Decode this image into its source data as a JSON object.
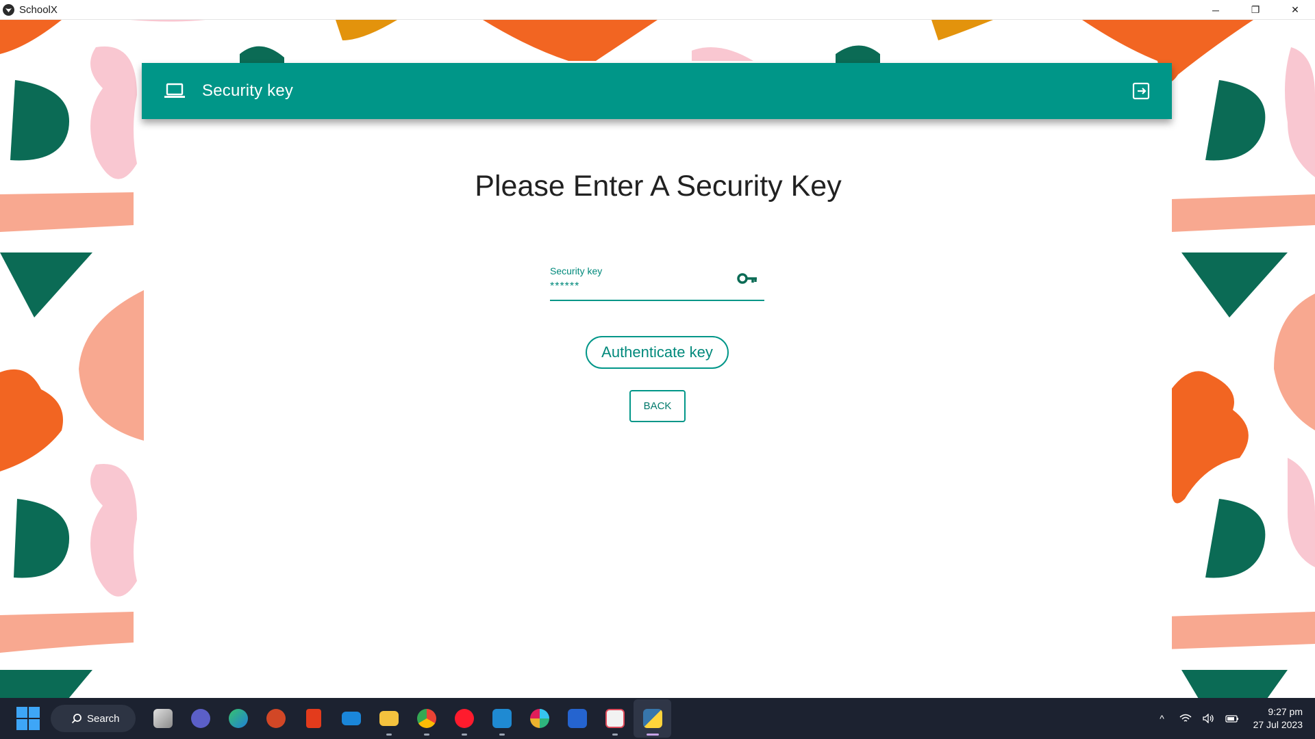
{
  "window": {
    "title": "SchoolX",
    "controls": {
      "minimize": "─",
      "restore": "❐",
      "close": "✕"
    }
  },
  "appbar": {
    "title": "Security key",
    "color": "#009688"
  },
  "main": {
    "heading": "Please Enter A Security Key",
    "security_field": {
      "label": "Security key",
      "value": "******"
    },
    "authenticate_label": "Authenticate key",
    "back_label": "BACK"
  },
  "taskbar": {
    "search_label": "Search",
    "apps": [
      "task-view",
      "meet",
      "edge",
      "powerpoint",
      "office",
      "mail",
      "file-explorer",
      "chrome",
      "opera",
      "vscode",
      "slack",
      "todo",
      "snipping-tool",
      "python"
    ],
    "tray": {
      "chevron": "^"
    },
    "clock": {
      "time": "9:27 pm",
      "date": "27 Jul 2023"
    }
  },
  "colors": {
    "teal": "#009688",
    "dark_green": "#0b6b55",
    "orange": "#f26522",
    "pink": "#f9c7d1",
    "salmon": "#f8a890",
    "mustard": "#e3930c"
  }
}
